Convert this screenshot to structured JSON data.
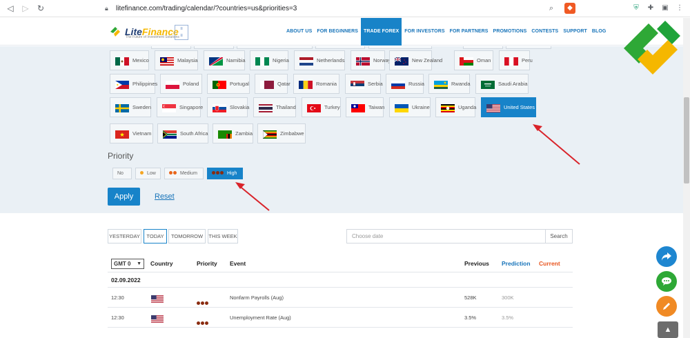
{
  "browser": {
    "url": "litefinance.com/trading/calendar/?countries=us&priorities=3"
  },
  "header": {
    "logo_text_1": "Lite",
    "logo_text_2": "Finance",
    "logo_tagline": "The Future of Investment Solutions",
    "menu": [
      {
        "label": "ABOUT US",
        "active": false
      },
      {
        "label": "FOR BEGINNERS",
        "active": false
      },
      {
        "label": "TRADE FOREX",
        "active": true
      },
      {
        "label": "FOR INVESTORS",
        "active": false
      },
      {
        "label": "FOR PARTNERS",
        "active": false
      },
      {
        "label": "PROMOTIONS",
        "active": false
      },
      {
        "label": "CONTESTS",
        "active": false
      },
      {
        "label": "SUPPORT",
        "active": false
      },
      {
        "label": "BLOG",
        "active": false
      }
    ]
  },
  "countries": [
    [
      {
        "name": "Mexico",
        "flag": "mx"
      },
      {
        "name": "Malaysia",
        "flag": "my"
      },
      {
        "name": "Namibia",
        "flag": "na"
      },
      {
        "name": "Nigeria",
        "flag": "ng"
      },
      {
        "name": "Netherlands",
        "flag": "nl"
      },
      {
        "name": "Norway",
        "flag": "no"
      },
      {
        "name": "New Zealand",
        "flag": "nz"
      },
      {
        "name": "Oman",
        "flag": "om"
      },
      {
        "name": "Peru",
        "flag": "pe"
      }
    ],
    [
      {
        "name": "Philippines",
        "flag": "ph"
      },
      {
        "name": "Poland",
        "flag": "pl"
      },
      {
        "name": "Portugal",
        "flag": "pt"
      },
      {
        "name": "Qatar",
        "flag": "qa"
      },
      {
        "name": "Romania",
        "flag": "ro"
      },
      {
        "name": "Serbia",
        "flag": "rs"
      },
      {
        "name": "Russia",
        "flag": "ru"
      },
      {
        "name": "Rwanda",
        "flag": "rw"
      },
      {
        "name": "Saudi Arabia",
        "flag": "sa"
      }
    ],
    [
      {
        "name": "Sweden",
        "flag": "se"
      },
      {
        "name": "Singapore",
        "flag": "sg"
      },
      {
        "name": "Slovakia",
        "flag": "sk"
      },
      {
        "name": "Thailand",
        "flag": "th"
      },
      {
        "name": "Turkey",
        "flag": "tr"
      },
      {
        "name": "Taiwan",
        "flag": "tw"
      },
      {
        "name": "Ukraine",
        "flag": "ua"
      },
      {
        "name": "Uganda",
        "flag": "ug"
      },
      {
        "name": "United States",
        "flag": "us",
        "selected": true
      }
    ],
    [
      {
        "name": "Vietnam",
        "flag": "vn"
      },
      {
        "name": "South Africa",
        "flag": "za"
      },
      {
        "name": "Zambia",
        "flag": "zm"
      },
      {
        "name": "Zimbabwe",
        "flag": "zw"
      }
    ]
  ],
  "priority": {
    "label": "Priority",
    "options": [
      {
        "label": "No",
        "dots": 0,
        "color": "#f5a623"
      },
      {
        "label": "Low",
        "dots": 1,
        "color": "#f5a623"
      },
      {
        "label": "Medium",
        "dots": 2,
        "color": "#e8651a"
      },
      {
        "label": "High",
        "dots": 3,
        "color": "#8a2c10",
        "selected": true
      }
    ]
  },
  "actions": {
    "apply": "Apply",
    "reset": "Reset"
  },
  "days": [
    "YESTERDAY",
    "TODAY",
    "TOMORROW",
    "THIS WEEK"
  ],
  "date_picker": {
    "placeholder": "Choose date",
    "search": "Search"
  },
  "table": {
    "timezone": "GMT 0",
    "headers": {
      "country": "Country",
      "priority": "Priority",
      "event": "Event",
      "previous": "Previous",
      "prediction": "Prediction",
      "current": "Current"
    },
    "date": "02.09.2022",
    "rows": [
      {
        "time": "12:30",
        "country_flag": "us",
        "priority_dots": 3,
        "event": "Nonfarm Payrolls (Aug)",
        "previous": "528K",
        "prediction": "300K",
        "current": ""
      },
      {
        "time": "12:30",
        "country_flag": "us",
        "priority_dots": 3,
        "event": "Unemployment Rate (Aug)",
        "previous": "3.5%",
        "prediction": "3.5%",
        "current": ""
      }
    ]
  },
  "colors": {
    "accent": "#1783c9",
    "prediction": "#1673b9",
    "current": "#e8541e",
    "arrow": "#d9232a"
  },
  "floating": {
    "share_icon": "share-arrow-icon",
    "chat_icon": "chat-icon",
    "edit_icon": "pencil-icon",
    "scroll_icon": "chevron-up-icon"
  }
}
